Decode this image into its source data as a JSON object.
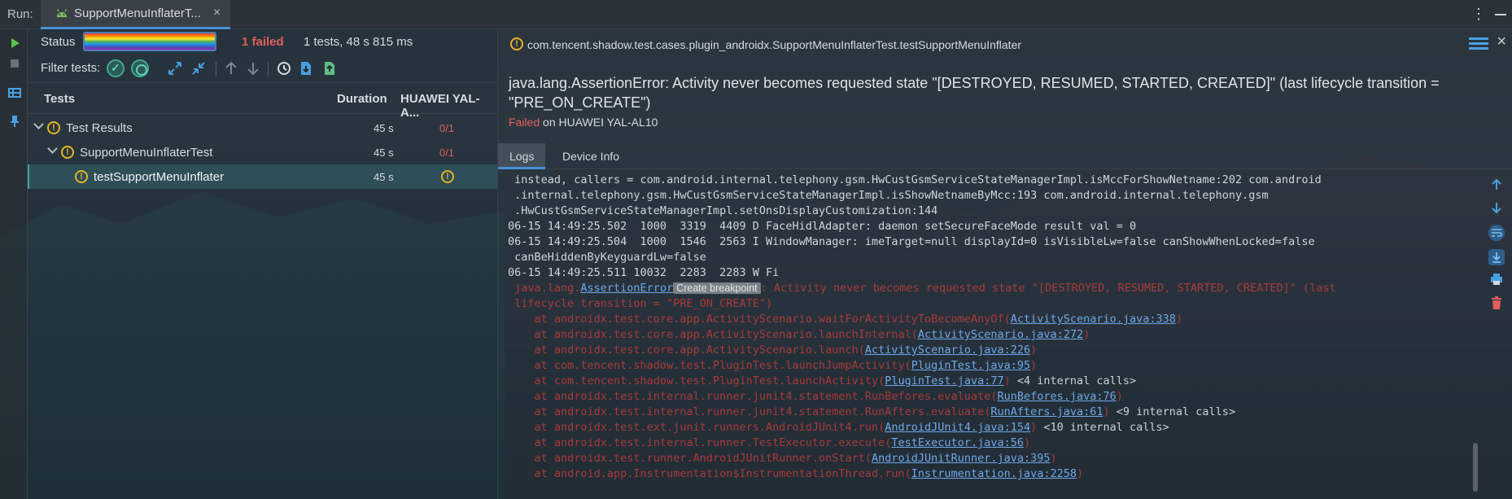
{
  "run": {
    "label": "Run:",
    "tab_title": "SupportMenuInflaterT...",
    "close_glyph": "×",
    "menu_glyph": "⋮"
  },
  "left": {
    "status_label": "Status",
    "progress_fraction": 1.0,
    "failed_text": "1 failed",
    "summary_text": "1 tests, 48 s 815 ms",
    "filter_label": "Filter tests:",
    "columns": {
      "tests": "Tests",
      "duration": "Duration",
      "device": "HUAWEI YAL-A..."
    },
    "tree": [
      {
        "name": "Test Results",
        "duration": "45 s",
        "result": "0/1"
      },
      {
        "name": "SupportMenuInflaterTest",
        "duration": "45 s",
        "result": "0/1"
      },
      {
        "name": "testSupportMenuInflater",
        "duration": "45 s",
        "result": ""
      }
    ]
  },
  "detail": {
    "test_name": "com.tencent.shadow.test.cases.plugin_androidx.SupportMenuInflaterTest.testSupportMenuInflater",
    "error_text": "java.lang.AssertionError: Activity never becomes requested state \"[DESTROYED, RESUMED, STARTED, CREATED]\" (last lifecycle transition = \"PRE_ON_CREATE\")",
    "failed_word": "Failed",
    "failed_on": " on HUAWEI YAL-AL10",
    "tabs": [
      "Logs",
      "Device Info"
    ]
  },
  "logs": {
    "line1": " instead, callers = com.android.internal.telephony.gsm.HwCustGsmServiceStateManagerImpl.isMccForShowNetname:202 com.android",
    "line2": " .internal.telephony.gsm.HwCustGsmServiceStateManagerImpl.isShowNetnameByMcc:193 com.android.internal.telephony.gsm",
    "line3": " .HwCustGsmServiceStateManagerImpl.setOnsDisplayCustomization:144",
    "line4": "06-15 14:49:25.502  1000  3319  4409 D FaceHidlAdapter: daemon setSecureFaceMode result val = 0",
    "line5": "06-15 14:49:25.504  1000  1546  2563 I WindowManager: imeTarget=null displayId=0 isVisibleLw=false canShowWhenLocked=false",
    "line6": " canBeHiddenByKeyguardLw=false",
    "line7": "06-15 14:49:25.511 10032  2283  2283 W Fi",
    "err_prefix": " java.lang.",
    "err_link": "AssertionError",
    "err_badge": "Create breakpoint",
    "err_rest": ": Activity never becomes requested state \"[DESTROYED, RESUMED, STARTED, CREATED]\" (last",
    "err_line2": " lifecycle transition = \"PRE_ON_CREATE\")",
    "stack": [
      {
        "pre": "    at androidx.test.core.app.ActivityScenario.waitForActivityToBecomeAnyOf(",
        "link": "ActivityScenario.java:338",
        "post": ")",
        "extra": ""
      },
      {
        "pre": "    at androidx.test.core.app.ActivityScenario.launchInternal(",
        "link": "ActivityScenario.java:272",
        "post": ")",
        "extra": ""
      },
      {
        "pre": "    at androidx.test.core.app.ActivityScenario.launch(",
        "link": "ActivityScenario.java:226",
        "post": ")",
        "extra": ""
      },
      {
        "pre": "    at com.tencent.shadow.test.PluginTest.launchJumpActivity(",
        "link": "PluginTest.java:95",
        "post": ")",
        "extra": ""
      },
      {
        "pre": "    at com.tencent.shadow.test.PluginTest.launchActivity(",
        "link": "PluginTest.java:77",
        "post": ")",
        "extra": " <4 internal calls>"
      },
      {
        "pre": "    at androidx.test.internal.runner.junit4.statement.RunBefores.evaluate(",
        "link": "RunBefores.java:76",
        "post": ")",
        "extra": ""
      },
      {
        "pre": "    at androidx.test.internal.runner.junit4.statement.RunAfters.evaluate(",
        "link": "RunAfters.java:61",
        "post": ")",
        "extra": " <9 internal calls>"
      },
      {
        "pre": "    at androidx.test.ext.junit.runners.AndroidJUnit4.run(",
        "link": "AndroidJUnit4.java:154",
        "post": ")",
        "extra": " <10 internal calls>"
      },
      {
        "pre": "    at androidx.test.internal.runner.TestExecutor.execute(",
        "link": "TestExecutor.java:56",
        "post": ")",
        "extra": ""
      },
      {
        "pre": "    at androidx.test.runner.AndroidJUnitRunner.onStart(",
        "link": "AndroidJUnitRunner.java:395",
        "post": ")",
        "extra": ""
      },
      {
        "pre": "    at android.app.Instrumentation$InstrumentationThread.run(",
        "link": "Instrumentation.java:2258",
        "post": ")",
        "extra": ""
      }
    ]
  },
  "colors": {
    "failed": "#e35d5d",
    "warning": "#e6b422",
    "link": "#6fa8e8",
    "accent": "#4a8fd6",
    "stack_error": "#a83a3a"
  },
  "icons": {
    "run_tab": "android-icon",
    "run": "play-icon",
    "stop": "stop-icon",
    "layout": "layout-icon",
    "pin": "pin-icon",
    "show_passed": "check-circle-icon",
    "show_ignored": "circle-target-icon",
    "expand": "expand-all-icon",
    "collapse": "collapse-all-icon",
    "prev": "arrow-up-icon",
    "next": "arrow-down-icon",
    "history": "history-icon",
    "import": "import-icon",
    "export": "export-icon",
    "warning": "warning-circle-icon",
    "hamburger": "menu-lines-icon",
    "scroll_up": "arrow-up-icon",
    "scroll_down": "arrow-down-icon",
    "soft_wrap": "soft-wrap-icon",
    "scroll_end": "scroll-to-end-icon",
    "print": "print-icon",
    "clear": "trash-icon"
  }
}
